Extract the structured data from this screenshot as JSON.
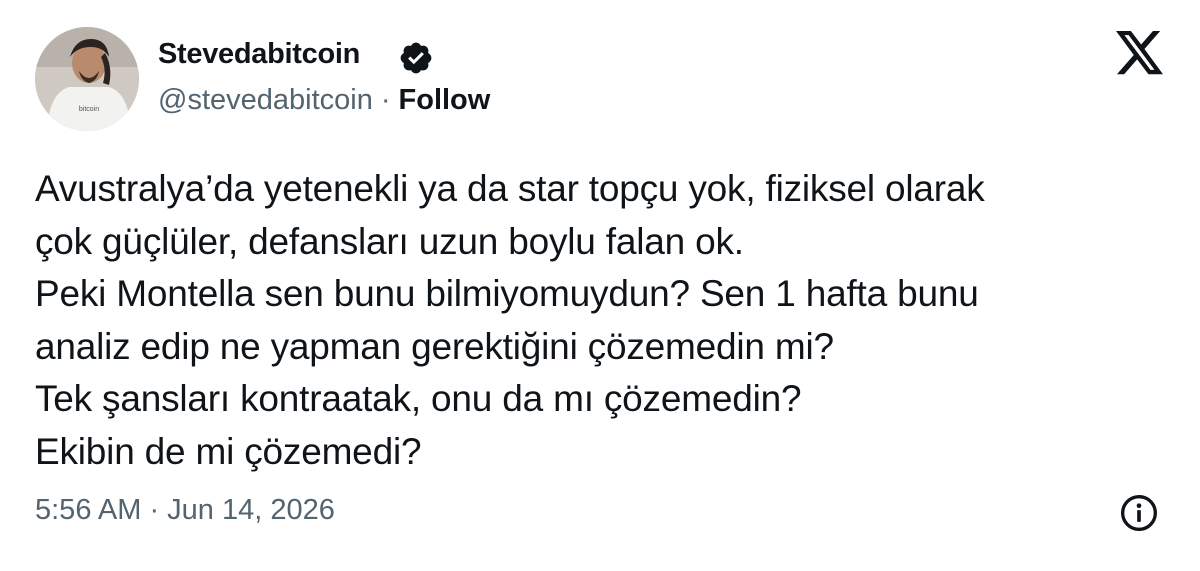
{
  "author": {
    "display_name": "Stevedabitcoin",
    "verified_icon": "verified-badge-icon",
    "handle": "@stevedabitcoin",
    "separator": "·",
    "follow_label": "Follow",
    "avatar_shirt_text": "bitcoin"
  },
  "platform": {
    "logo_icon": "x-logo-icon"
  },
  "tweet": {
    "lines": [
      "Avustralya’da yetenekli ya da star topçu yok, fiziksel olarak",
      "çok güçlüler, defansları uzun boylu falan ok.",
      "Peki Montella sen bunu bilmiyomuydun? Sen 1 hafta bunu",
      "analiz edip ne yapman gerektiğini çözemedin mi?",
      "Tek şansları kontraatak, onu da mı çözemedin?",
      "Ekibin de mi çözemedi?"
    ],
    "timestamp": "5:56 AM · Jun 14, 2026"
  },
  "actions": {
    "info_icon": "info-icon"
  },
  "colors": {
    "text": "#0f1419",
    "secondary": "#536471",
    "background": "#ffffff"
  }
}
